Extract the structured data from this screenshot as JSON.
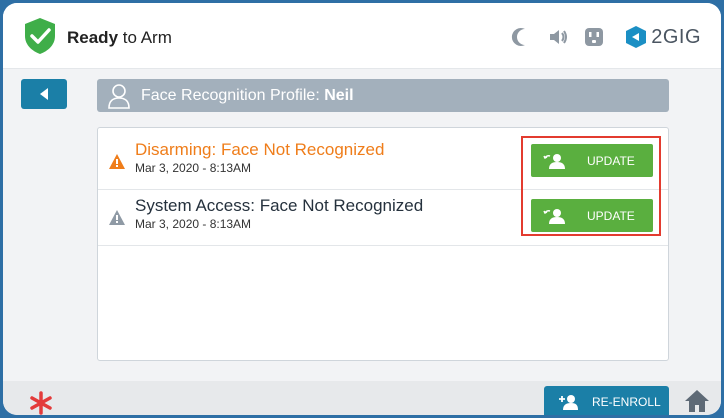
{
  "status": {
    "bold": "Ready",
    "rest": " to Arm"
  },
  "brand": {
    "name": "2GIG"
  },
  "icons": {
    "status": "check-shield-icon",
    "night": "moon-icon",
    "volume": "speaker-icon",
    "outlet": "outlet-icon",
    "back": "back-arrow-icon",
    "home": "home-icon",
    "emergency": "asterisk-icon"
  },
  "title_bar": {
    "label": "Face Recognition Profile: ",
    "name": "Neil"
  },
  "events": [
    {
      "title": "Disarming: Face Not Recognized",
      "date": "Mar 3, 2020 - 8:13AM",
      "severity_color": "#ef7d1a",
      "button": "UPDATE"
    },
    {
      "title": "System Access: Face Not Recognized",
      "date": "Mar 3, 2020 - 8:13AM",
      "severity_color": "#8f9aa5",
      "button": "UPDATE"
    }
  ],
  "footer": {
    "reenroll": "RE-ENROLL"
  },
  "colors": {
    "accent_blue": "#1b7fa7",
    "green": "#5aaf3f",
    "highlight": "#e33b2f",
    "orange": "#ef7d1a"
  }
}
